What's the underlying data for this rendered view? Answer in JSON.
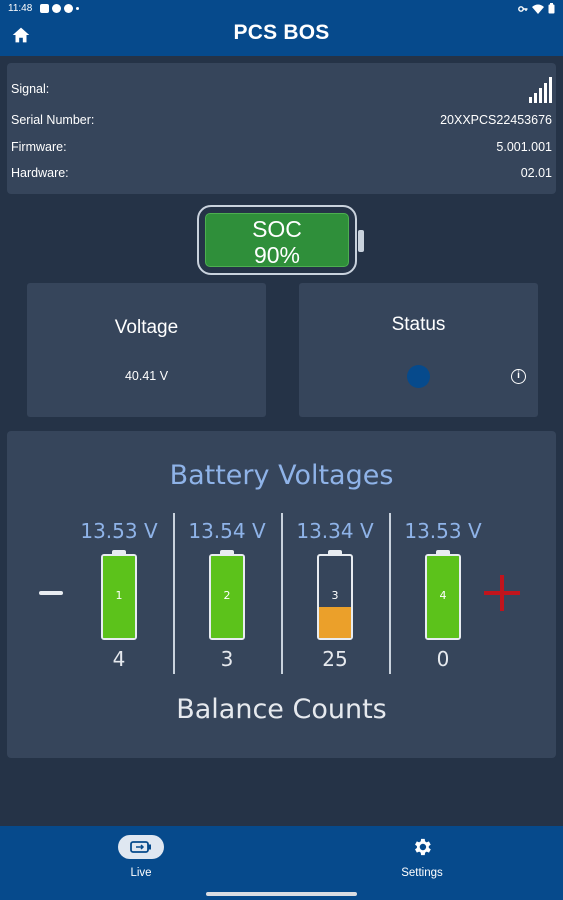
{
  "status_bar": {
    "time": "11:48",
    "notification_icons": [
      "image-icon",
      "circle-icon",
      "google-icon",
      "dot-icon"
    ],
    "system_icons": [
      "key-icon",
      "wifi-icon",
      "battery-icon"
    ]
  },
  "app_bar": {
    "title": "PCS BOS",
    "home_icon": "home-icon"
  },
  "device_info": {
    "signal_label": "Signal:",
    "signal_level_bars": 5,
    "serial_label": "Serial Number:",
    "serial_value": "20XXPCS22453676",
    "firmware_label": "Firmware:",
    "firmware_value": "5.001.001",
    "hardware_label": "Hardware:",
    "hardware_value": "02.01"
  },
  "soc": {
    "label": "SOC",
    "value": "90%",
    "level_fraction": 0.9,
    "color": "#2f8f3a"
  },
  "voltage_tile": {
    "title": "Voltage",
    "value": "40.41 V"
  },
  "status_tile": {
    "title": "Status",
    "indicator_color": "#064a8c",
    "info_icon": "info-icon",
    "info_glyph": "i"
  },
  "battery_voltages": {
    "title": "Battery Voltages",
    "footer_title": "Balance Counts",
    "decrease_icon": "minus-icon",
    "increase_icon": "plus-icon",
    "cells": [
      {
        "number": "1",
        "voltage": "13.53 V",
        "balance_count": "4",
        "fill_fraction": 1.0,
        "color": "#5cc21b"
      },
      {
        "number": "2",
        "voltage": "13.54 V",
        "balance_count": "3",
        "fill_fraction": 1.0,
        "color": "#5cc21b"
      },
      {
        "number": "3",
        "voltage": "13.34 V",
        "balance_count": "25",
        "fill_fraction": 0.38,
        "color": "#eba02a"
      },
      {
        "number": "4",
        "voltage": "13.53 V",
        "balance_count": "0",
        "fill_fraction": 1.0,
        "color": "#5cc21b"
      }
    ]
  },
  "bottom_nav": {
    "items": [
      {
        "label": "Live",
        "icon": "battery-icon",
        "selected": true
      },
      {
        "label": "Settings",
        "icon": "gear-icon",
        "selected": false
      }
    ]
  },
  "colors": {
    "brand": "#064a8c",
    "background": "#253347",
    "card": "#36455b",
    "voltage_text": "#8fb3e8",
    "plus_red": "#c0141c"
  }
}
